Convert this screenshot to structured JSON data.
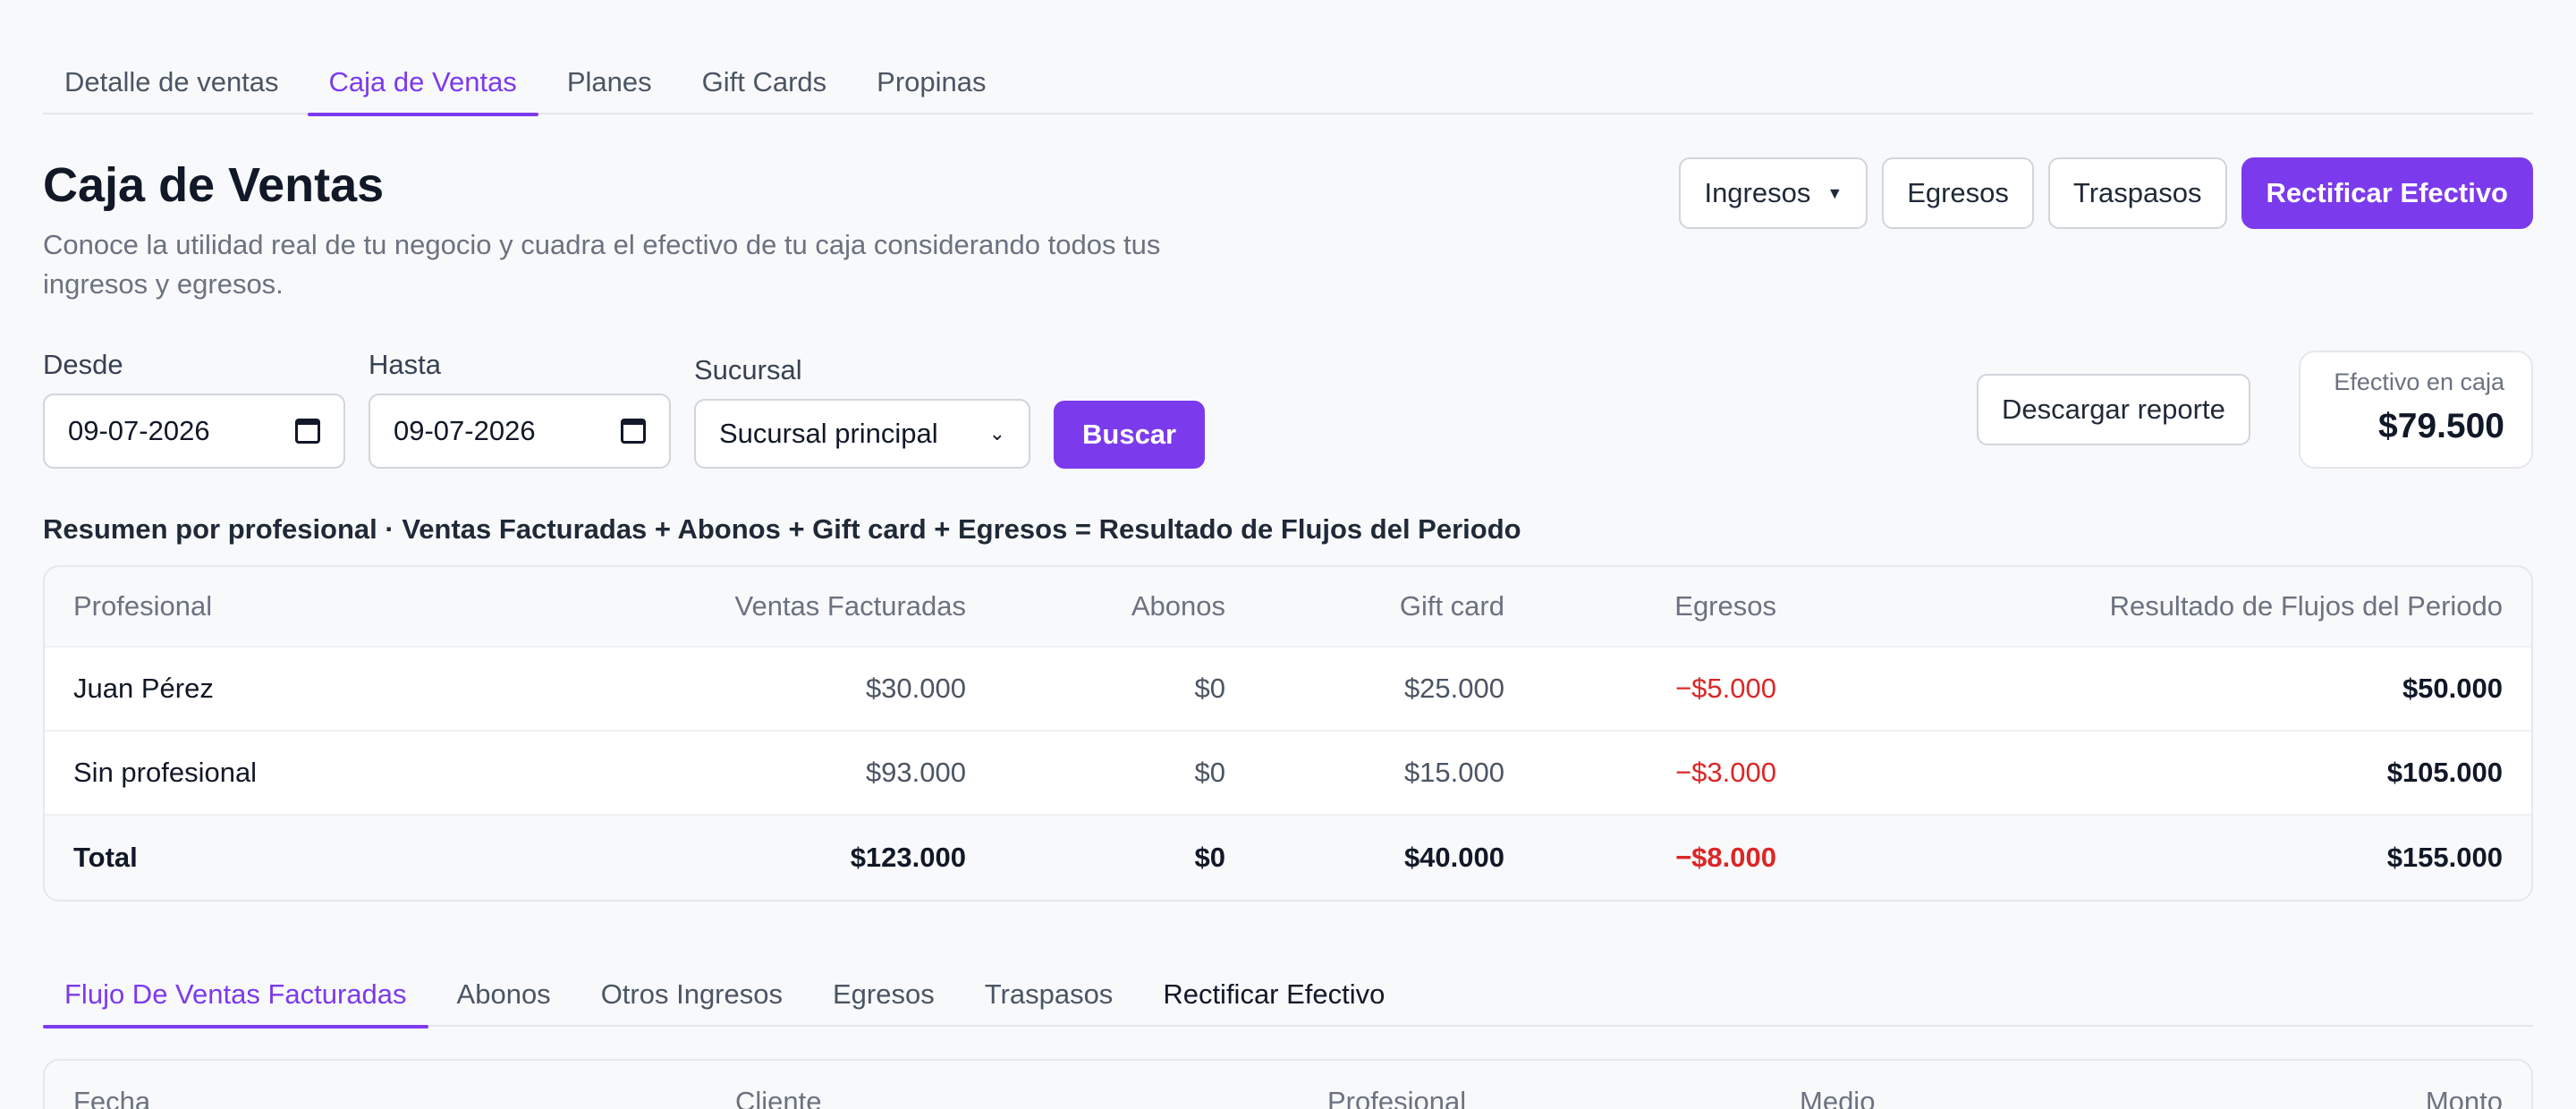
{
  "top_tabs": [
    "Detalle de ventas",
    "Caja de Ventas",
    "Planes",
    "Gift Cards",
    "Propinas"
  ],
  "page": {
    "title": "Caja de Ventas",
    "subtitle": "Conoce la utilidad real de tu negocio y cuadra el efectivo de tu caja considerando todos tus ingresos y egresos."
  },
  "actions": {
    "ingresos": "Ingresos",
    "caret": "▼",
    "egresos": "Egresos",
    "traspasos": "Traspasos",
    "rectificar": "Rectificar Efectivo"
  },
  "filters": {
    "desde_label": "Desde",
    "desde_value": "09-07-2026",
    "hasta_label": "Hasta",
    "hasta_value": "09-07-2026",
    "sucursal_label": "Sucursal",
    "sucursal_value": "Sucursal principal",
    "buscar": "Buscar"
  },
  "report": {
    "download": "Descargar reporte",
    "cash_label": "Efectivo en caja",
    "cash_value": "$79.500"
  },
  "summary": {
    "title": "Resumen por profesional · Ventas Facturadas + Abonos + Gift card + Egresos = Resultado de Flujos del Periodo",
    "headers": [
      "Profesional",
      "Ventas Facturadas",
      "Abonos",
      "Gift card",
      "Egresos",
      "Resultado de Flujos del Periodo"
    ],
    "rows": [
      [
        "Juan Pérez",
        "$30.000",
        "$0",
        "$25.000",
        "−$5.000",
        "$50.000"
      ],
      [
        "Sin profesional",
        "$93.000",
        "$0",
        "$15.000",
        "−$3.000",
        "$105.000"
      ]
    ],
    "total": [
      "Total",
      "$123.000",
      "$0",
      "$40.000",
      "−$8.000",
      "$155.000"
    ]
  },
  "bottom_tabs": [
    "Flujo De Ventas Facturadas",
    "Abonos",
    "Otros Ingresos",
    "Egresos",
    "Traspasos",
    "Rectificar Efectivo"
  ],
  "flow_table": {
    "headers": [
      "Fecha",
      "Cliente",
      "Profesional",
      "Medio",
      "Monto"
    ]
  }
}
